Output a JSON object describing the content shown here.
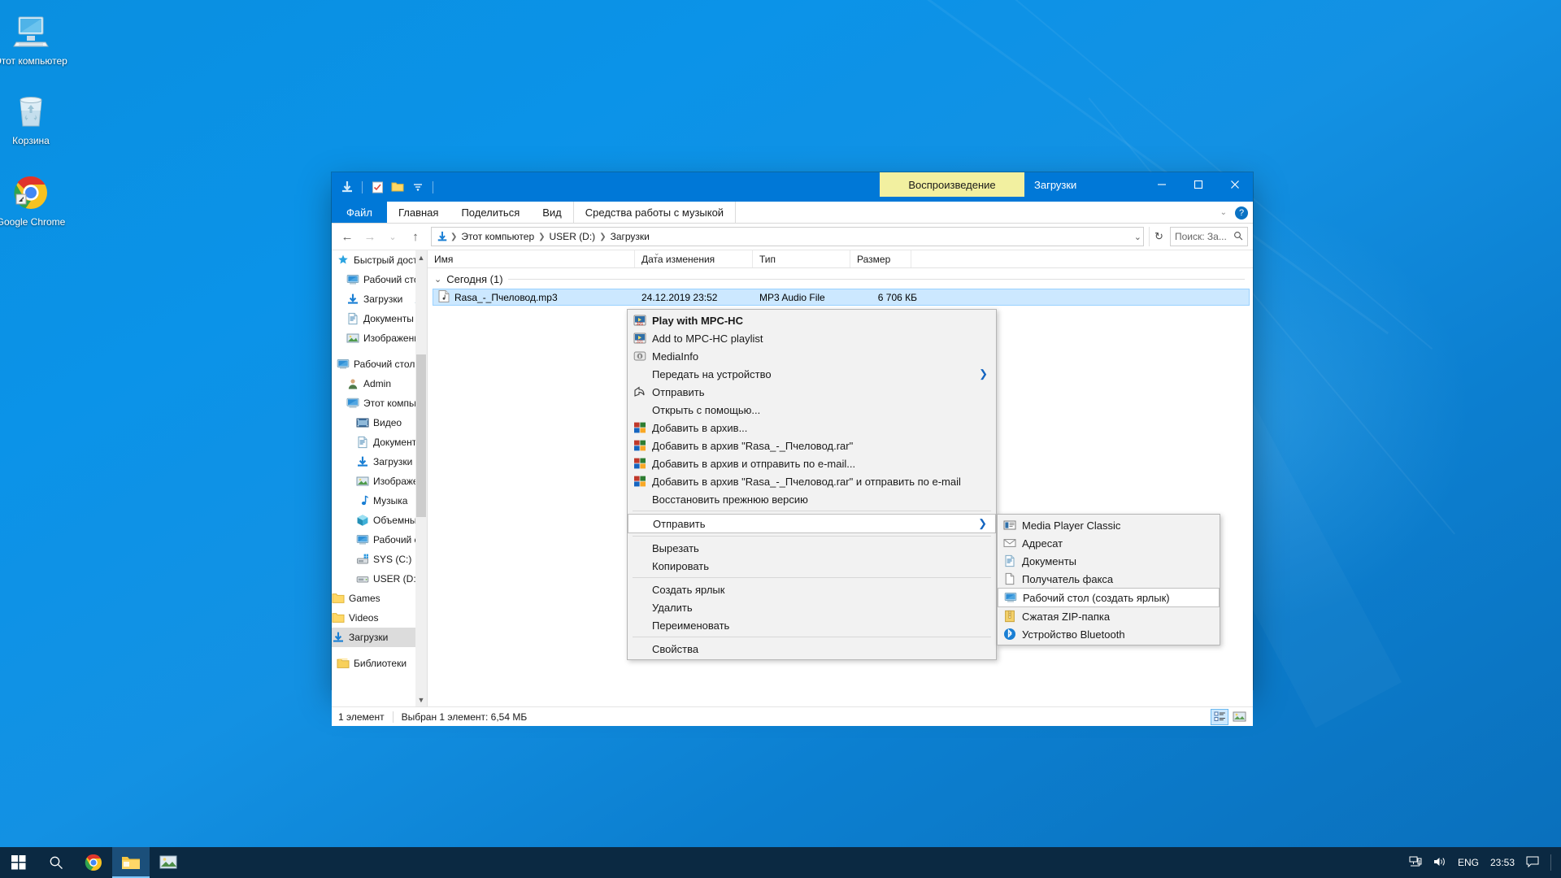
{
  "desktop": {
    "icons": [
      {
        "name": "this-pc",
        "label": "Этот компьютер"
      },
      {
        "name": "recycle-bin",
        "label": "Корзина"
      },
      {
        "name": "google-chrome",
        "label": "Google Chrome"
      }
    ]
  },
  "window": {
    "title": "Загрузки",
    "contextual_tab": "Воспроизведение",
    "ribbon_tabs": [
      "Файл",
      "Главная",
      "Поделиться",
      "Вид"
    ],
    "contextual_tools": "Средства работы с музыкой",
    "minimize": "—",
    "maximize": "☐",
    "close": "✕",
    "help": "?",
    "quick_access_icons": [
      "download-icon",
      "properties-icon",
      "new-folder-icon",
      "customize-chevron-icon"
    ]
  },
  "address": {
    "back": "←",
    "forward": "→",
    "recent": "⌄",
    "up": "↑",
    "crumbs": [
      "Этот компьютер",
      "USER (D:)",
      "Загрузки"
    ],
    "dropdown": "⌄",
    "refresh": "↻",
    "search_placeholder": "Поиск: За...",
    "search_icon": "search-icon"
  },
  "nav": {
    "items": [
      {
        "label": "Быстрый доступ",
        "icon": "star-pin-icon",
        "depth": 0,
        "pinned": false,
        "selected": false
      },
      {
        "label": "Рабочий сто.",
        "icon": "desktop-icon",
        "depth": 1,
        "pinned": true,
        "selected": false
      },
      {
        "label": "Загрузки",
        "icon": "download-icon",
        "depth": 1,
        "pinned": true,
        "selected": false
      },
      {
        "label": "Документы",
        "icon": "documents-icon",
        "depth": 1,
        "pinned": true,
        "selected": false
      },
      {
        "label": "Изображени",
        "icon": "pictures-icon",
        "depth": 1,
        "pinned": true,
        "selected": false
      },
      {
        "label": "Рабочий стол",
        "icon": "desktop-icon",
        "depth": 0,
        "pinned": false,
        "selected": false
      },
      {
        "label": "Admin",
        "icon": "user-icon",
        "depth": 1,
        "pinned": false,
        "selected": false
      },
      {
        "label": "Этот компьютер",
        "icon": "this-pc-icon",
        "depth": 1,
        "pinned": false,
        "selected": false
      },
      {
        "label": "Видео",
        "icon": "videos-icon",
        "depth": 2,
        "pinned": false,
        "selected": false
      },
      {
        "label": "Документы",
        "icon": "documents-icon",
        "depth": 2,
        "pinned": false,
        "selected": false
      },
      {
        "label": "Загрузки",
        "icon": "download-icon",
        "depth": 2,
        "pinned": false,
        "selected": false
      },
      {
        "label": "Изображения",
        "icon": "pictures-icon",
        "depth": 2,
        "pinned": false,
        "selected": false
      },
      {
        "label": "Музыка",
        "icon": "music-icon",
        "depth": 2,
        "pinned": false,
        "selected": false
      },
      {
        "label": "Объемные об",
        "icon": "3d-objects-icon",
        "depth": 2,
        "pinned": false,
        "selected": false
      },
      {
        "label": "Рабочий стол",
        "icon": "desktop-icon",
        "depth": 2,
        "pinned": false,
        "selected": false
      },
      {
        "label": "SYS (C:)",
        "icon": "system-drive-icon",
        "depth": 2,
        "pinned": false,
        "selected": false
      },
      {
        "label": "USER (D:)",
        "icon": "drive-icon",
        "depth": 2,
        "pinned": false,
        "selected": false
      },
      {
        "label": "Games",
        "icon": "folder-icon",
        "depth": 3,
        "pinned": false,
        "selected": false
      },
      {
        "label": "Videos",
        "icon": "folder-icon",
        "depth": 3,
        "pinned": false,
        "selected": false
      },
      {
        "label": "Загрузки",
        "icon": "download-icon",
        "depth": 3,
        "pinned": false,
        "selected": true
      },
      {
        "label": "Библиотеки",
        "icon": "libraries-icon",
        "depth": 0,
        "pinned": false,
        "selected": false
      }
    ]
  },
  "files": {
    "columns": [
      "Имя",
      "Дата изменения",
      "Тип",
      "Размер"
    ],
    "group_label": "Сегодня (1)",
    "rows": [
      {
        "name": "Rasa_-_Пчеловод.mp3",
        "date": "24.12.2019 23:52",
        "type": "MP3 Audio File",
        "size": "6 706 КБ",
        "icon": "mp3-file-icon"
      }
    ]
  },
  "status": {
    "count": "1 элемент",
    "selection": "Выбран 1 элемент: 6,54 МБ",
    "view_details": "details-view-icon",
    "view_large": "large-icons-view-icon"
  },
  "context_menu": {
    "items": [
      {
        "label": "Play with MPC-HC",
        "icon": "mpc-hc-icon",
        "bold": true,
        "arrow": false,
        "sep_after": false
      },
      {
        "label": "Add to MPC-HC playlist",
        "icon": "mpc-hc-icon",
        "bold": false,
        "arrow": false,
        "sep_after": false
      },
      {
        "label": "MediaInfo",
        "icon": "mediainfo-icon",
        "bold": false,
        "arrow": false,
        "sep_after": false
      },
      {
        "label": "Передать на устройство",
        "icon": "",
        "bold": false,
        "arrow": true,
        "sep_after": false
      },
      {
        "label": "Отправить",
        "icon": "share-icon",
        "bold": false,
        "arrow": false,
        "sep_after": false
      },
      {
        "label": "Открыть с помощью...",
        "icon": "",
        "bold": false,
        "arrow": false,
        "sep_after": false
      },
      {
        "label": "Добавить в архив...",
        "icon": "winrar-icon",
        "bold": false,
        "arrow": false,
        "sep_after": false
      },
      {
        "label": "Добавить в архив \"Rasa_-_Пчеловод.rar\"",
        "icon": "winrar-icon",
        "bold": false,
        "arrow": false,
        "sep_after": false
      },
      {
        "label": "Добавить в архив и отправить по e-mail...",
        "icon": "winrar-icon",
        "bold": false,
        "arrow": false,
        "sep_after": false
      },
      {
        "label": "Добавить в архив \"Rasa_-_Пчеловод.rar\" и отправить по e-mail",
        "icon": "winrar-icon",
        "bold": false,
        "arrow": false,
        "sep_after": false
      },
      {
        "label": "Восстановить прежнюю версию",
        "icon": "",
        "bold": false,
        "arrow": false,
        "sep_after": true
      },
      {
        "label": "Отправить",
        "icon": "",
        "bold": false,
        "arrow": true,
        "sep_after": true,
        "highlighted": true
      },
      {
        "label": "Вырезать",
        "icon": "",
        "bold": false,
        "arrow": false,
        "sep_after": false
      },
      {
        "label": "Копировать",
        "icon": "",
        "bold": false,
        "arrow": false,
        "sep_after": true
      },
      {
        "label": "Создать ярлык",
        "icon": "",
        "bold": false,
        "arrow": false,
        "sep_after": false
      },
      {
        "label": "Удалить",
        "icon": "",
        "bold": false,
        "arrow": false,
        "sep_after": false
      },
      {
        "label": "Переименовать",
        "icon": "",
        "bold": false,
        "arrow": false,
        "sep_after": true
      },
      {
        "label": "Свойства",
        "icon": "",
        "bold": false,
        "arrow": false,
        "sep_after": false
      }
    ]
  },
  "submenu": {
    "items": [
      {
        "label": "Media Player Classic",
        "icon": "mpc-shortcut-icon",
        "highlighted": false
      },
      {
        "label": "Адресат",
        "icon": "mail-recipient-icon",
        "highlighted": false
      },
      {
        "label": "Документы",
        "icon": "documents-icon",
        "highlighted": false
      },
      {
        "label": "Получатель факса",
        "icon": "fax-recipient-icon",
        "highlighted": false
      },
      {
        "label": "Рабочий стол (создать ярлык)",
        "icon": "desktop-icon",
        "highlighted": true
      },
      {
        "label": "Сжатая ZIP-папка",
        "icon": "zip-folder-icon",
        "highlighted": false
      },
      {
        "label": "Устройство Bluetooth",
        "icon": "bluetooth-icon",
        "highlighted": false
      }
    ]
  },
  "taskbar": {
    "start": "start-icon",
    "items": [
      {
        "name": "search-icon",
        "active": false
      },
      {
        "name": "chrome-icon",
        "active": false
      },
      {
        "name": "file-explorer-icon",
        "active": true
      },
      {
        "name": "photos-icon",
        "active": false
      }
    ],
    "tray": {
      "network": "network-icon",
      "volume": "volume-icon",
      "language": "ENG",
      "time": "23:53",
      "notifications": "notification-icon"
    }
  }
}
